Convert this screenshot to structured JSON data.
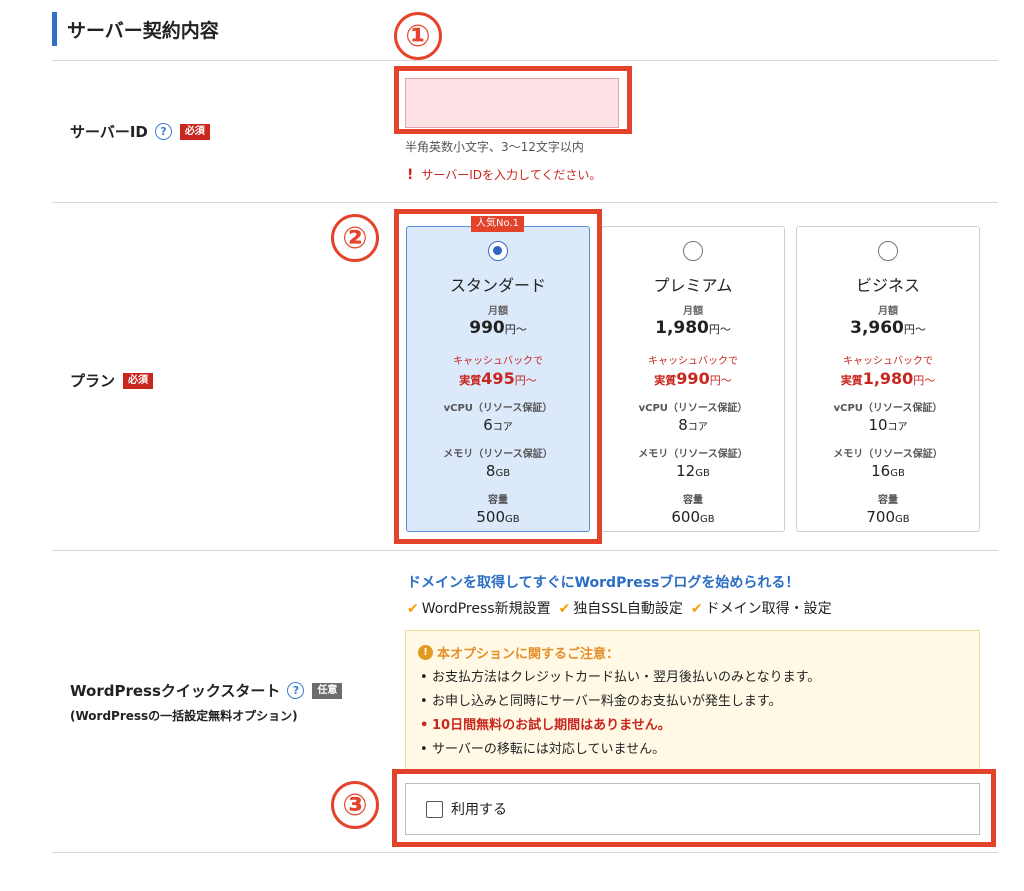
{
  "section": {
    "title": "サーバー契約内容"
  },
  "markers": {
    "one": "①",
    "two": "②",
    "three": "③"
  },
  "server_id": {
    "label": "サーバーID",
    "help": "?",
    "required": "必須",
    "value": "",
    "hint": "半角英数小文字、3〜12文字以内",
    "error_mark": "!",
    "error": "サーバーIDを入力してください。"
  },
  "plan": {
    "label": "プラン",
    "required": "必須",
    "popular_badge": "人気No.1",
    "month_label": "月額",
    "yen_from": "円〜",
    "cashback_label": "キャッシュバックで",
    "effective_prefix": "実質",
    "cpu_label": "vCPU（リソース保証）",
    "mem_label": "メモリ（リソース保証）",
    "disk_label": "容量",
    "core_unit": "コア",
    "gb_unit": "GB",
    "items": [
      {
        "name": "スタンダード",
        "price": "990",
        "effective": "495",
        "cpu": "6",
        "memory": "8",
        "disk": "500",
        "selected": true
      },
      {
        "name": "プレミアム",
        "price": "1,980",
        "effective": "990",
        "cpu": "8",
        "memory": "12",
        "disk": "600",
        "selected": false
      },
      {
        "name": "ビジネス",
        "price": "3,960",
        "effective": "1,980",
        "cpu": "10",
        "memory": "16",
        "disk": "700",
        "selected": false
      }
    ]
  },
  "wordpress": {
    "label": "WordPressクイックスタート",
    "help": "?",
    "optional": "任意",
    "sub_label": "(WordPressの一括設定無料オプション)",
    "headline": "ドメインを取得してすぐにWordPressブログを始められる！",
    "features": [
      "WordPress新規設置",
      "独自SSL自動設定",
      "ドメイン取得・設定"
    ],
    "check_mark": "✔",
    "notice_icon": "!",
    "notice_title": "本オプションに関するご注意：",
    "notices": [
      "お支払方法はクレジットカード払い・翌月後払いのみとなります。",
      "お申し込みと同時にサーバー料金のお支払いが発生します。",
      "10日間無料のお試し期間はありません。",
      "サーバーの移転には対応していません。"
    ],
    "use_label": "利用する",
    "use_checked": false
  },
  "colors": {
    "accent": "#2f6fc6",
    "required": "#c8261e",
    "marker": "#e3422b",
    "selected_plan": "#dce9fb"
  }
}
